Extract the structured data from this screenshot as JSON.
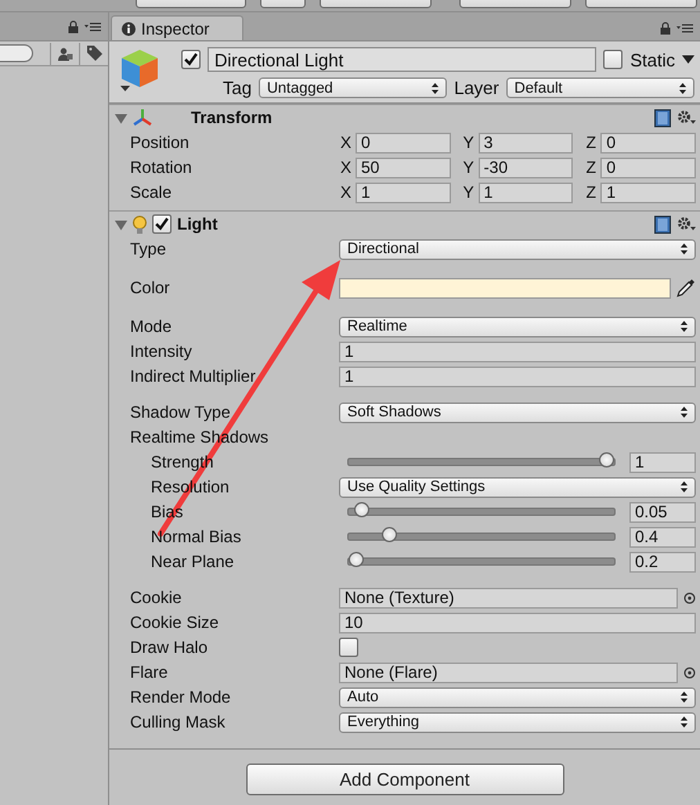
{
  "inspector": {
    "tab": {
      "label": "Inspector",
      "selected": true
    },
    "object": {
      "active": true,
      "name": "Directional Light",
      "static": {
        "label": "Static",
        "checked": false
      },
      "tag": {
        "label": "Tag",
        "value": "Untagged"
      },
      "layer": {
        "label": "Layer",
        "value": "Default"
      }
    },
    "components": [
      {
        "kind": "transform",
        "title": "Transform",
        "expanded": true,
        "rows": [
          {
            "label": "Position",
            "axes": [
              {
                "axis": "X",
                "value": "0"
              },
              {
                "axis": "Y",
                "value": "3"
              },
              {
                "axis": "Z",
                "value": "0"
              }
            ]
          },
          {
            "label": "Rotation",
            "axes": [
              {
                "axis": "X",
                "value": "50"
              },
              {
                "axis": "Y",
                "value": "-30"
              },
              {
                "axis": "Z",
                "value": "0"
              }
            ]
          },
          {
            "label": "Scale",
            "axes": [
              {
                "axis": "X",
                "value": "1"
              },
              {
                "axis": "Y",
                "value": "1"
              },
              {
                "axis": "Z",
                "value": "1"
              }
            ]
          }
        ]
      },
      {
        "kind": "light",
        "title": "Light",
        "enabled": true,
        "expanded": true,
        "groups": [
          [
            {
              "kind": "dropdown",
              "label": "Type",
              "value": "Directional"
            }
          ],
          [
            {
              "kind": "color",
              "label": "Color",
              "color": "#fff4d6"
            }
          ],
          [
            {
              "kind": "dropdown",
              "label": "Mode",
              "value": "Realtime"
            },
            {
              "kind": "number",
              "label": "Intensity",
              "value": "1"
            },
            {
              "kind": "number",
              "label": "Indirect Multiplier",
              "value": "1"
            }
          ],
          [
            {
              "kind": "dropdown",
              "label": "Shadow Type",
              "value": "Soft Shadows"
            },
            {
              "kind": "section",
              "label": "Realtime Shadows",
              "children": [
                {
                  "kind": "slider",
                  "label": "Strength",
                  "level": 1,
                  "value": "1"
                },
                {
                  "kind": "dropdown",
                  "label": "Resolution",
                  "value": "Use Quality Settings"
                },
                {
                  "kind": "slider",
                  "label": "Bias",
                  "level": 0.02,
                  "value": "0.05"
                },
                {
                  "kind": "slider",
                  "label": "Normal Bias",
                  "level": 0.13,
                  "value": "0.4"
                },
                {
                  "kind": "slider",
                  "label": "Near Plane",
                  "level": 0,
                  "value": "0.2"
                }
              ]
            }
          ],
          [
            {
              "kind": "object",
              "label": "Cookie",
              "value": "None (Texture)"
            },
            {
              "kind": "number",
              "label": "Cookie Size",
              "value": "10"
            },
            {
              "kind": "checkbox",
              "label": "Draw Halo",
              "checked": false
            },
            {
              "kind": "object",
              "label": "Flare",
              "value": "None (Flare)"
            },
            {
              "kind": "dropdown",
              "label": "Render Mode",
              "value": "Auto"
            },
            {
              "kind": "dropdown",
              "label": "Culling Mask",
              "value": "Everything"
            }
          ]
        ]
      }
    ],
    "add_component": "Add Component"
  },
  "annotation": {
    "kind": "arrow"
  }
}
